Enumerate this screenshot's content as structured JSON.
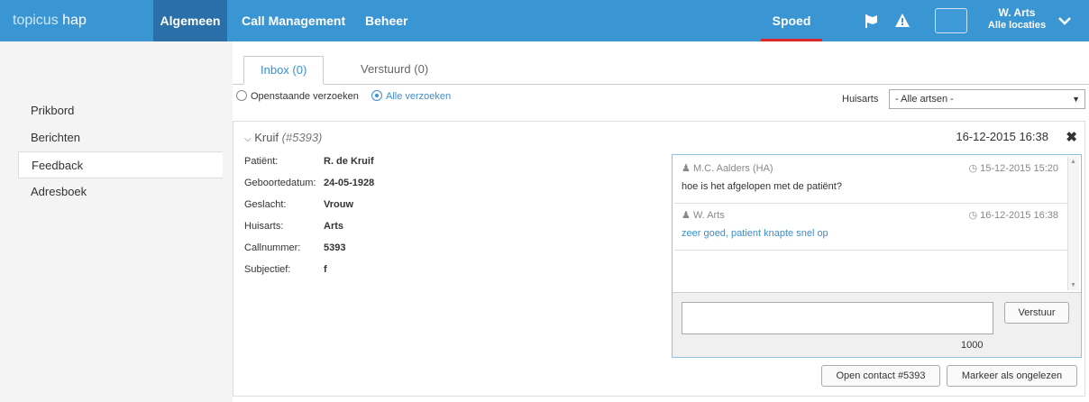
{
  "brand": {
    "part1": "topicus",
    "part2": "hap"
  },
  "nav": {
    "items": [
      "Algemeen",
      "Call Management",
      "Beheer"
    ],
    "spoed": "Spoed"
  },
  "user": {
    "name": "W. Arts",
    "location": "Alle locaties"
  },
  "sidebar": {
    "items": [
      "Prikbord",
      "Berichten",
      "Feedback",
      "Adresboek"
    ],
    "active": "Feedback"
  },
  "tabs": [
    {
      "label": "Inbox (0)"
    },
    {
      "label": "Verstuurd (0)"
    }
  ],
  "filters": {
    "option1": "Openstaande verzoeken",
    "option2": "Alle verzoeken",
    "selected": "Alle verzoeken"
  },
  "huisarts": {
    "label": "Huisarts",
    "value": "- Alle artsen -"
  },
  "card": {
    "name": "Kruif",
    "number": "(#5393)",
    "datetime": "16-12-2015 16:38",
    "details": [
      {
        "label": "Patiënt:",
        "value": "R. de Kruif"
      },
      {
        "label": "Geboortedatum:",
        "value": "24-05-1928"
      },
      {
        "label": "Geslacht:",
        "value": "Vrouw"
      },
      {
        "label": "Huisarts:",
        "value": "Arts"
      },
      {
        "label": "Callnummer:",
        "value": "5393"
      },
      {
        "label": "Subjectief:",
        "value": "f"
      }
    ]
  },
  "messages": [
    {
      "from": "M.C. Aalders (HA)",
      "time": "15-12-2015 15:20",
      "text": "hoe is het afgelopen met de patiënt?"
    },
    {
      "from": "W. Arts",
      "time": "16-12-2015 16:38",
      "text": "zeer goed, patient knapte snel op"
    }
  ],
  "composer": {
    "send": "Verstuur",
    "counter": "1000"
  },
  "actions": {
    "open_contact": "Open contact #5393",
    "mark_unread": "Markeer als ongelezen"
  },
  "colors": {
    "topbar": "#3a95d3",
    "accent": "#3a8fd0",
    "spoed_underline": "#d9272e"
  }
}
